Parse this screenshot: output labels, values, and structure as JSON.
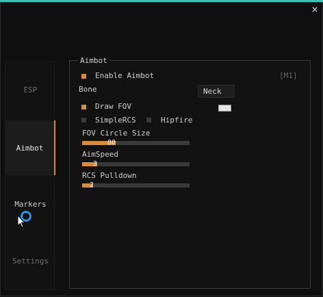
{
  "window": {
    "close_glyph": "×",
    "accent": "#3ec0b6"
  },
  "sidebar": {
    "tabs": [
      {
        "label": "ESP"
      },
      {
        "label": "Aimbot"
      },
      {
        "label": "Markers"
      },
      {
        "label": "Settings"
      }
    ]
  },
  "aimbot": {
    "title": "Aimbot",
    "enable_label": "Enable Aimbot",
    "enable_checked": true,
    "hotkey": "[M1]",
    "bone_label": "Bone",
    "bone_value": "Neck",
    "draw_fov_label": "Draw FOV",
    "draw_fov_checked": true,
    "simple_rcs_label": "SimpleRCS",
    "simple_rcs_checked": false,
    "hipfire_label": "Hipfire",
    "hipfire_checked": false,
    "fov_label": "FOV Circle Size",
    "fov_value": "80",
    "fov_fraction": 0.31,
    "aimspeed_label": "AimSpeed",
    "aimspeed_value": "3",
    "aimspeed_fraction": 0.14,
    "rcs_label": "RCS Pulldown",
    "rcs_value": "2",
    "rcs_fraction": 0.1
  },
  "colors": {
    "checked": "#d98a3a",
    "unchecked": "#3a3a3a",
    "fov_color": "#e6e6e6"
  }
}
